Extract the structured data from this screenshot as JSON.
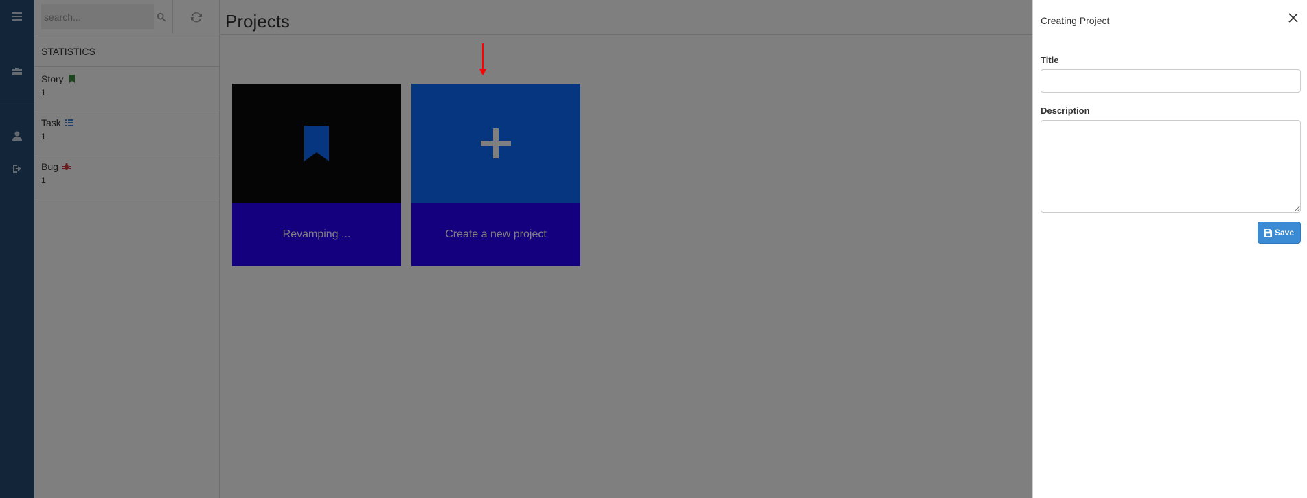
{
  "search": {
    "placeholder": "search..."
  },
  "stats": {
    "title": "STATISTICS",
    "items": [
      {
        "label": "Story",
        "count": "1",
        "icon": "bookmark-icon",
        "color": "#3c8c3c"
      },
      {
        "label": "Task",
        "count": "1",
        "icon": "tasks-icon",
        "color": "#3a7fd8"
      },
      {
        "label": "Bug",
        "count": "1",
        "icon": "bug-icon",
        "color": "#d43a3a"
      }
    ]
  },
  "main": {
    "title": "Projects",
    "cards": [
      {
        "label": "Revamping ...",
        "icon": "bookmark-icon"
      },
      {
        "label": "Create a new project",
        "icon": "plus-icon"
      }
    ]
  },
  "drawer": {
    "title": "Creating Project",
    "title_label": "Title",
    "title_value": "",
    "description_label": "Description",
    "description_value": "",
    "save_label": "Save"
  },
  "colors": {
    "rail": "#254b73",
    "card_bottom": "#2800ff",
    "card_create_top": "#0b6cff",
    "save_button": "#3a8bd4"
  }
}
